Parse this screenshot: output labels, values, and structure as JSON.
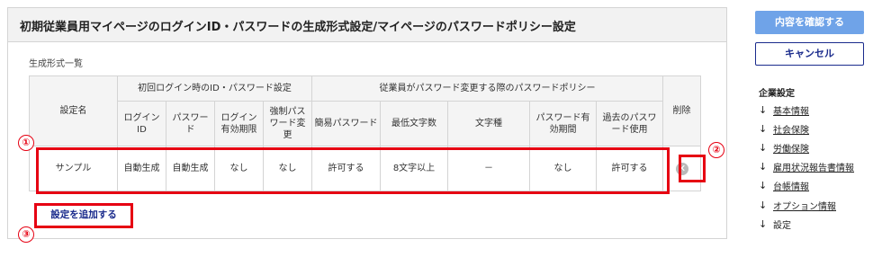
{
  "panel": {
    "title": "初期従業員用マイページのログインID・パスワードの生成形式設定/マイページのパスワードポリシー設定",
    "section_label": "生成形式一覧"
  },
  "table": {
    "headers": {
      "name": "設定名",
      "group_initial": "初回ログイン時のID・パスワード設定",
      "group_policy": "従業員がパスワード変更する際のパスワードポリシー",
      "delete": "削除",
      "login_id": "ログインID",
      "password": "パスワード",
      "login_expiry": "ログイン有効期限",
      "forced_change": "強制パスワード変更",
      "simple_password": "簡易パスワード",
      "min_length": "最低文字数",
      "char_type": "文字種",
      "password_expiry": "パスワード有効期間",
      "past_password": "過去のパスワード使用"
    },
    "row": {
      "name": "サンプル",
      "login_id": "自動生成",
      "password": "自動生成",
      "login_expiry": "なし",
      "forced_change": "なし",
      "simple_password": "許可する",
      "min_length": "8文字以上",
      "char_type": "－",
      "password_expiry": "なし",
      "past_password": "許可する",
      "delete_icon": "close-circle-icon"
    }
  },
  "add_link": "設定を追加する",
  "markers": [
    "①",
    "②",
    "③"
  ],
  "buttons": {
    "confirm": "内容を確認する",
    "cancel": "キャンセル"
  },
  "sidebar": {
    "heading": "企業設定",
    "items": [
      {
        "label": "基本情報"
      },
      {
        "label": "社会保険"
      },
      {
        "label": "労働保険"
      },
      {
        "label": "雇用状況報告書情報"
      },
      {
        "label": "台帳情報"
      },
      {
        "label": "オプション情報"
      },
      {
        "label": "設定"
      }
    ]
  },
  "colors": {
    "annotation": "#e60012",
    "primary": "#6fa3e8",
    "navy": "#1a2b8c"
  }
}
